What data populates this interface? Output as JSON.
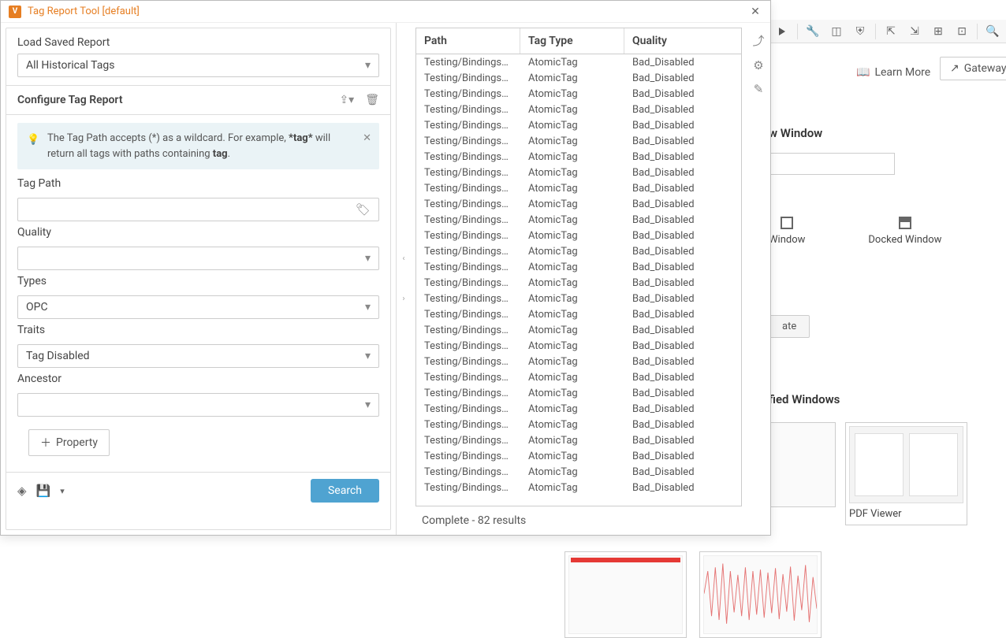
{
  "dialog": {
    "title": "Tag Report Tool [default]",
    "load_saved_label": "Load Saved Report",
    "load_saved_value": "All Historical Tags",
    "configure_title": "Configure Tag Report",
    "hint_part1": "The Tag Path accepts (*) as a wildcard. For example, ",
    "hint_bold1": "*tag*",
    "hint_part2": " will return all tags with paths containing ",
    "hint_bold2": "tag",
    "hint_part3": ".",
    "fields": {
      "tag_path_label": "Tag Path",
      "tag_path_value": "",
      "quality_label": "Quality",
      "quality_value": "",
      "types_label": "Types",
      "types_value": "OPC",
      "traits_label": "Traits",
      "traits_value": "Tag Disabled",
      "ancestor_label": "Ancestor",
      "ancestor_value": ""
    },
    "property_btn": "Property",
    "search_btn": "Search",
    "status": "Complete - 82 results"
  },
  "table": {
    "columns": [
      "Path",
      "Tag Type",
      "Quality"
    ],
    "rows": [
      {
        "path": "Testing/Bindings/...",
        "type": "AtomicTag",
        "quality": "Bad_Disabled"
      },
      {
        "path": "Testing/Bindings/...",
        "type": "AtomicTag",
        "quality": "Bad_Disabled"
      },
      {
        "path": "Testing/Bindings/...",
        "type": "AtomicTag",
        "quality": "Bad_Disabled"
      },
      {
        "path": "Testing/Bindings/...",
        "type": "AtomicTag",
        "quality": "Bad_Disabled"
      },
      {
        "path": "Testing/Bindings/...",
        "type": "AtomicTag",
        "quality": "Bad_Disabled"
      },
      {
        "path": "Testing/Bindings/...",
        "type": "AtomicTag",
        "quality": "Bad_Disabled"
      },
      {
        "path": "Testing/Bindings/...",
        "type": "AtomicTag",
        "quality": "Bad_Disabled"
      },
      {
        "path": "Testing/Bindings/...",
        "type": "AtomicTag",
        "quality": "Bad_Disabled"
      },
      {
        "path": "Testing/Bindings/...",
        "type": "AtomicTag",
        "quality": "Bad_Disabled"
      },
      {
        "path": "Testing/Bindings/...",
        "type": "AtomicTag",
        "quality": "Bad_Disabled"
      },
      {
        "path": "Testing/Bindings/...",
        "type": "AtomicTag",
        "quality": "Bad_Disabled"
      },
      {
        "path": "Testing/Bindings/...",
        "type": "AtomicTag",
        "quality": "Bad_Disabled"
      },
      {
        "path": "Testing/Bindings/...",
        "type": "AtomicTag",
        "quality": "Bad_Disabled"
      },
      {
        "path": "Testing/Bindings/...",
        "type": "AtomicTag",
        "quality": "Bad_Disabled"
      },
      {
        "path": "Testing/Bindings/...",
        "type": "AtomicTag",
        "quality": "Bad_Disabled"
      },
      {
        "path": "Testing/Bindings/...",
        "type": "AtomicTag",
        "quality": "Bad_Disabled"
      },
      {
        "path": "Testing/Bindings/...",
        "type": "AtomicTag",
        "quality": "Bad_Disabled"
      },
      {
        "path": "Testing/Bindings/...",
        "type": "AtomicTag",
        "quality": "Bad_Disabled"
      },
      {
        "path": "Testing/Bindings/...",
        "type": "AtomicTag",
        "quality": "Bad_Disabled"
      },
      {
        "path": "Testing/Bindings/...",
        "type": "AtomicTag",
        "quality": "Bad_Disabled"
      },
      {
        "path": "Testing/Bindings/...",
        "type": "AtomicTag",
        "quality": "Bad_Disabled"
      },
      {
        "path": "Testing/Bindings/...",
        "type": "AtomicTag",
        "quality": "Bad_Disabled"
      },
      {
        "path": "Testing/Bindings/...",
        "type": "AtomicTag",
        "quality": "Bad_Disabled"
      },
      {
        "path": "Testing/Bindings/...",
        "type": "AtomicTag",
        "quality": "Bad_Disabled"
      },
      {
        "path": "Testing/Bindings/...",
        "type": "AtomicTag",
        "quality": "Bad_Disabled"
      },
      {
        "path": "Testing/Bindings/...",
        "type": "AtomicTag",
        "quality": "Bad_Disabled"
      },
      {
        "path": "Testing/Bindings/...",
        "type": "AtomicTag",
        "quality": "Bad_Disabled"
      },
      {
        "path": "Testing/Bindings/...",
        "type": "AtomicTag",
        "quality": "Bad_Disabled"
      }
    ]
  },
  "background": {
    "learn_more": "Learn More",
    "gateway": "Gateway",
    "new_window_title": "w Window",
    "main_window": "Window",
    "docked_window": "Docked Window",
    "create_btn": "ate",
    "classified_windows": "fied Windows",
    "pdf_viewer": "PDF Viewer"
  }
}
